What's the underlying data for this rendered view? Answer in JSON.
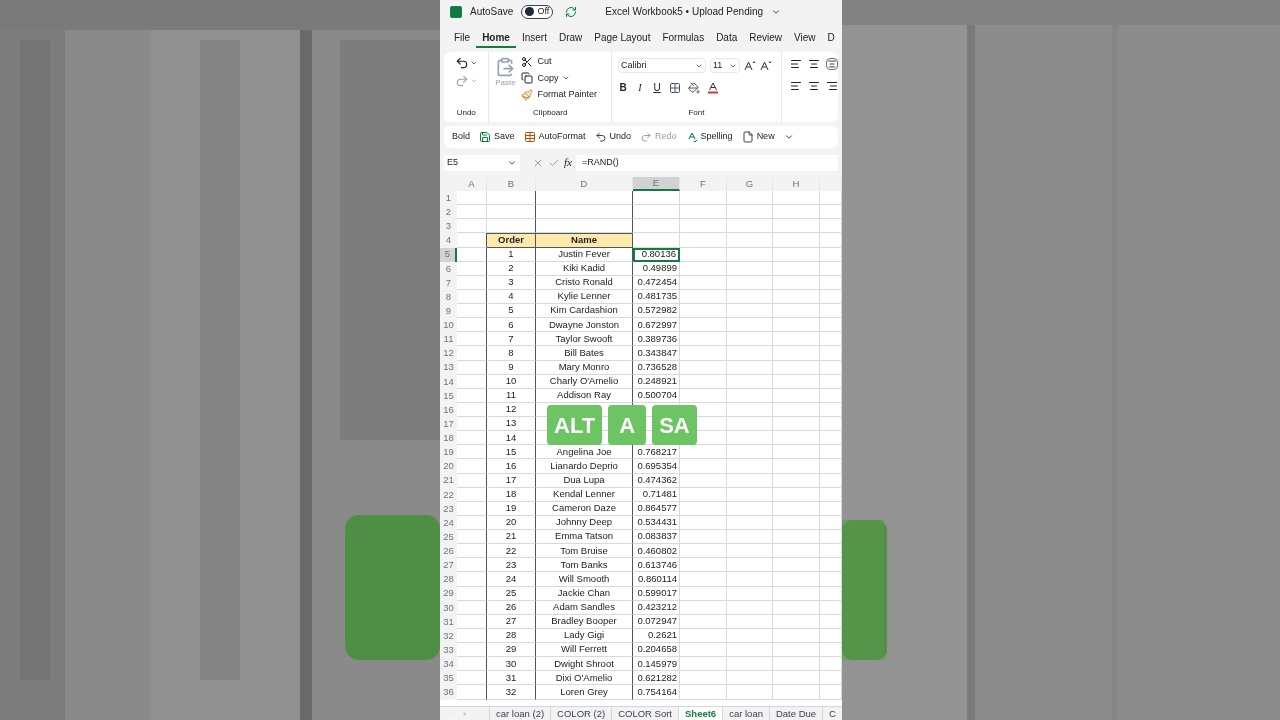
{
  "title_bar": {
    "autosave_label": "AutoSave",
    "autosave_state": "Off",
    "autosave_on": false,
    "document_title": "Excel Workbook5 • Upload Pending"
  },
  "menu_tabs": [
    {
      "label": "File",
      "selected": false
    },
    {
      "label": "Home",
      "selected": true
    },
    {
      "label": "Insert",
      "selected": false
    },
    {
      "label": "Draw",
      "selected": false
    },
    {
      "label": "Page Layout",
      "selected": false
    },
    {
      "label": "Formulas",
      "selected": false
    },
    {
      "label": "Data",
      "selected": false
    },
    {
      "label": "Review",
      "selected": false
    },
    {
      "label": "View",
      "selected": false
    },
    {
      "label": "D",
      "selected": false
    }
  ],
  "ribbon": {
    "undo_group": "Undo",
    "paste": "Paste",
    "cut": "Cut",
    "copy": "Copy",
    "format_painter": "Format Painter",
    "clipboard_group": "Clipboard",
    "font_name": "Calibri",
    "font_size": "11",
    "bold": "B",
    "italic": "I",
    "underline": "U",
    "font_group": "Font"
  },
  "quick_access": [
    {
      "label": "Bold",
      "kind": "bold",
      "disabled": false
    },
    {
      "label": "Save",
      "kind": "save",
      "disabled": false
    },
    {
      "label": "AutoFormat",
      "kind": "table",
      "disabled": false
    },
    {
      "label": "Undo",
      "kind": "undo",
      "disabled": false
    },
    {
      "label": "Redo",
      "kind": "redo",
      "disabled": true
    },
    {
      "label": "Spelling",
      "kind": "spelling",
      "disabled": false
    },
    {
      "label": "New",
      "kind": "new",
      "disabled": false
    }
  ],
  "formula_bar": {
    "name_box": "E5",
    "fx": "fx",
    "formula": "=RAND()"
  },
  "columns": [
    {
      "label": "A",
      "selected": false
    },
    {
      "label": "B",
      "selected": false
    },
    {
      "label": "D",
      "selected": false
    },
    {
      "label": "E",
      "selected": true
    },
    {
      "label": "F",
      "selected": false
    },
    {
      "label": "G",
      "selected": false
    },
    {
      "label": "H",
      "selected": false
    }
  ],
  "rows": [
    {
      "row": "1",
      "kind": "empty",
      "selected": false
    },
    {
      "row": "2",
      "kind": "empty",
      "selected": false
    },
    {
      "row": "3",
      "kind": "empty",
      "selected": false
    },
    {
      "row": "4",
      "kind": "header",
      "order": "Order",
      "name": "Name",
      "selected": false
    },
    {
      "row": "5",
      "kind": "data",
      "order": "1",
      "name": "Justin Fever",
      "value": "0.80136",
      "selected": true
    },
    {
      "row": "6",
      "kind": "data",
      "order": "2",
      "name": "Kiki Kadid",
      "value": "0.49899",
      "selected": false
    },
    {
      "row": "7",
      "kind": "data",
      "order": "3",
      "name": "Cristo Ronald",
      "value": "0.472454",
      "selected": false
    },
    {
      "row": "8",
      "kind": "data",
      "order": "4",
      "name": "Kylie Lenner",
      "value": "0.481735",
      "selected": false
    },
    {
      "row": "9",
      "kind": "data",
      "order": "5",
      "name": "Kim Cardashion",
      "value": "0.572982",
      "selected": false
    },
    {
      "row": "10",
      "kind": "data",
      "order": "6",
      "name": "Dwayne Jonston",
      "value": "0.672997",
      "selected": false
    },
    {
      "row": "11",
      "kind": "data",
      "order": "7",
      "name": "Taylor Swooft",
      "value": "0.389736",
      "selected": false
    },
    {
      "row": "12",
      "kind": "data",
      "order": "8",
      "name": "Bill Bates",
      "value": "0.343847",
      "selected": false
    },
    {
      "row": "13",
      "kind": "data",
      "order": "9",
      "name": "Mary Monro",
      "value": "0.736528",
      "selected": false
    },
    {
      "row": "14",
      "kind": "data",
      "order": "10",
      "name": "Charly O'Amelio",
      "value": "0.248921",
      "selected": false
    },
    {
      "row": "15",
      "kind": "data",
      "order": "11",
      "name": "Addison Ray",
      "value": "0.500704",
      "selected": false
    },
    {
      "row": "16",
      "kind": "data",
      "order": "12",
      "selected": false
    },
    {
      "row": "17",
      "kind": "data",
      "order": "13",
      "selected": false
    },
    {
      "row": "18",
      "kind": "data",
      "order": "14",
      "selected": false
    },
    {
      "row": "19",
      "kind": "data",
      "order": "15",
      "name": "Angelina Joe",
      "value": "0.768217",
      "selected": false
    },
    {
      "row": "20",
      "kind": "data",
      "order": "16",
      "name": "Lianardo Deprio",
      "value": "0.695354",
      "selected": false
    },
    {
      "row": "21",
      "kind": "data",
      "order": "17",
      "name": "Dua Lupa",
      "value": "0.474362",
      "selected": false
    },
    {
      "row": "22",
      "kind": "data",
      "order": "18",
      "name": "Kendal Lenner",
      "value": "0.71481",
      "selected": false
    },
    {
      "row": "23",
      "kind": "data",
      "order": "19",
      "name": "Cameron Daze",
      "value": "0.864577",
      "selected": false
    },
    {
      "row": "24",
      "kind": "data",
      "order": "20",
      "name": "Johnny Deep",
      "value": "0.534431",
      "selected": false
    },
    {
      "row": "25",
      "kind": "data",
      "order": "21",
      "name": "Emma Tatson",
      "value": "0.083837",
      "selected": false
    },
    {
      "row": "26",
      "kind": "data",
      "order": "22",
      "name": "Tom Bruise",
      "value": "0.460802",
      "selected": false
    },
    {
      "row": "27",
      "kind": "data",
      "order": "23",
      "name": "Tom Banks",
      "value": "0.613746",
      "selected": false
    },
    {
      "row": "28",
      "kind": "data",
      "order": "24",
      "name": "Will Smooth",
      "value": "0.860114",
      "selected": false
    },
    {
      "row": "29",
      "kind": "data",
      "order": "25",
      "name": "Jackie Chan",
      "value": "0.599017",
      "selected": false
    },
    {
      "row": "30",
      "kind": "data",
      "order": "26",
      "name": "Adam Sandles",
      "value": "0.423212",
      "selected": false
    },
    {
      "row": "31",
      "kind": "data",
      "order": "27",
      "name": "Bradley Booper",
      "value": "0.072947",
      "selected": false
    },
    {
      "row": "32",
      "kind": "data",
      "order": "28",
      "name": "Lady Gigi",
      "value": "0.2621",
      "selected": false
    },
    {
      "row": "33",
      "kind": "data",
      "order": "29",
      "name": "Will Ferrett",
      "value": "0.204658",
      "selected": false
    },
    {
      "row": "34",
      "kind": "data",
      "order": "30",
      "name": "Dwight Shroot",
      "value": "0.145979",
      "selected": false
    },
    {
      "row": "35",
      "kind": "data",
      "order": "31",
      "name": "Dixi O'Amelio",
      "value": "0.621282",
      "selected": false
    },
    {
      "row": "36",
      "kind": "data",
      "order": "32",
      "name": "Loren Grey",
      "value": "0.754164",
      "selected": false
    }
  ],
  "key_overlay": [
    "ALT",
    "A",
    "SA"
  ],
  "sheet_tabs": [
    {
      "label": "car loan (2)",
      "selected": false
    },
    {
      "label": "COLOR (2)",
      "selected": false
    },
    {
      "label": "COLOR Sort",
      "selected": false
    },
    {
      "label": "Sheet6",
      "selected": true
    },
    {
      "label": "car loan",
      "selected": false
    },
    {
      "label": "Date Due",
      "selected": false
    },
    {
      "label": "C",
      "selected": false
    }
  ]
}
